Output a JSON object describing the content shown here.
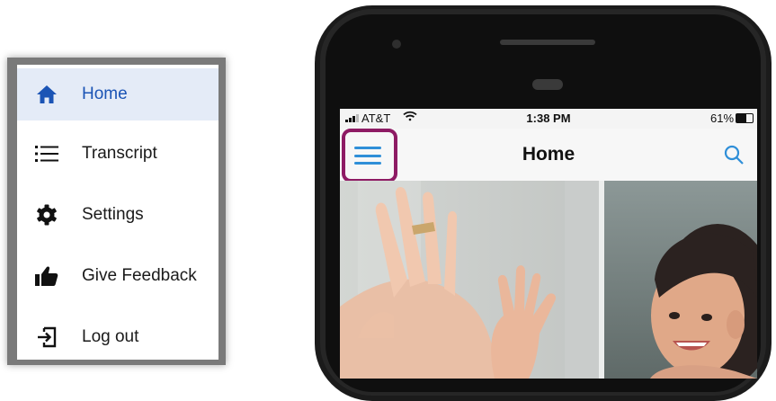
{
  "menu": {
    "items": [
      {
        "icon": "home-icon",
        "label": "Home",
        "active": true
      },
      {
        "icon": "list-icon",
        "label": "Transcript",
        "active": false
      },
      {
        "icon": "gear-icon",
        "label": "Settings",
        "active": false
      },
      {
        "icon": "thumbs-up-icon",
        "label": "Give Feedback",
        "active": false
      },
      {
        "icon": "logout-icon",
        "label": "Log out",
        "active": false
      }
    ],
    "active_color": "#1b54b5",
    "active_bg": "#e4ebf7"
  },
  "phone": {
    "status": {
      "carrier": "AT&T",
      "time": "1:38 PM",
      "battery": "61%",
      "battery_level": 0.61
    },
    "nav": {
      "title": "Home",
      "menu_icon": "hamburger-menu-icon",
      "search_icon": "search-icon"
    },
    "highlight_color": "#8e1b64",
    "accent": "#2f8fd8",
    "hero_image": "photo of an adult hand giving a high five to a smiling young child"
  }
}
